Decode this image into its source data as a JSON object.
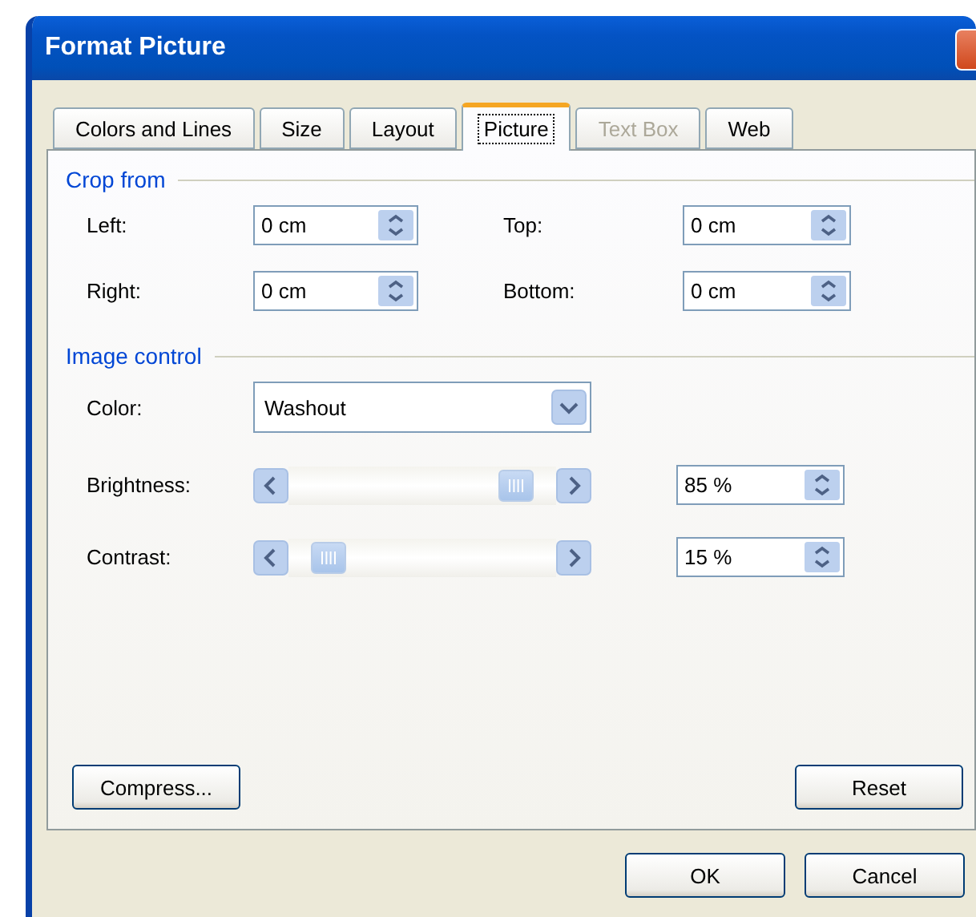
{
  "window": {
    "title": "Format Picture"
  },
  "tabs": [
    {
      "label": "Colors and Lines",
      "selected": false,
      "disabled": false
    },
    {
      "label": "Size",
      "selected": false,
      "disabled": false
    },
    {
      "label": "Layout",
      "selected": false,
      "disabled": false
    },
    {
      "label": "Picture",
      "selected": true,
      "disabled": false
    },
    {
      "label": "Text Box",
      "selected": false,
      "disabled": true
    },
    {
      "label": "Web",
      "selected": false,
      "disabled": false
    }
  ],
  "crop_from": {
    "title": "Crop from",
    "fields": [
      {
        "label": "Left:",
        "value": "0 cm"
      },
      {
        "label": "Top:",
        "value": "0 cm"
      },
      {
        "label": "Right:",
        "value": "0 cm"
      },
      {
        "label": "Bottom:",
        "value": "0 cm"
      }
    ]
  },
  "image_control": {
    "title": "Image control",
    "color": {
      "label": "Color:",
      "value": "Washout"
    },
    "sliders": [
      {
        "label": "Brightness:",
        "level": 0.85,
        "value": "85 %"
      },
      {
        "label": "Contrast:",
        "level": 0.15,
        "value": "15 %"
      }
    ]
  },
  "panel_buttons": [
    "Compress...",
    "Reset"
  ],
  "buttons": [
    "OK",
    "Cancel"
  ]
}
